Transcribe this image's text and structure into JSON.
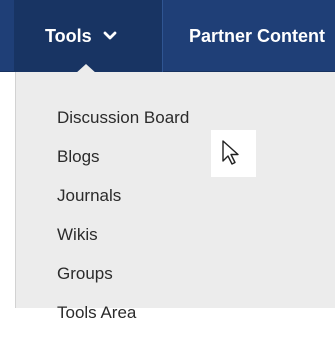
{
  "nav": {
    "tools_label": "Tools",
    "partner_label": "Partner Content",
    "chevron_icon": "chevron-down-icon"
  },
  "tools_menu": {
    "items": [
      "Discussion Board",
      "Blogs",
      "Journals",
      "Wikis",
      "Groups",
      "Tools Area"
    ]
  },
  "cursor": {
    "icon": "mouse-pointer-icon"
  },
  "colors": {
    "nav_background": "#1f3f77",
    "active_tab_background": "#183463",
    "menu_background": "#ececec",
    "text_dark": "#2b2b2b",
    "nav_text": "#ffffff"
  }
}
